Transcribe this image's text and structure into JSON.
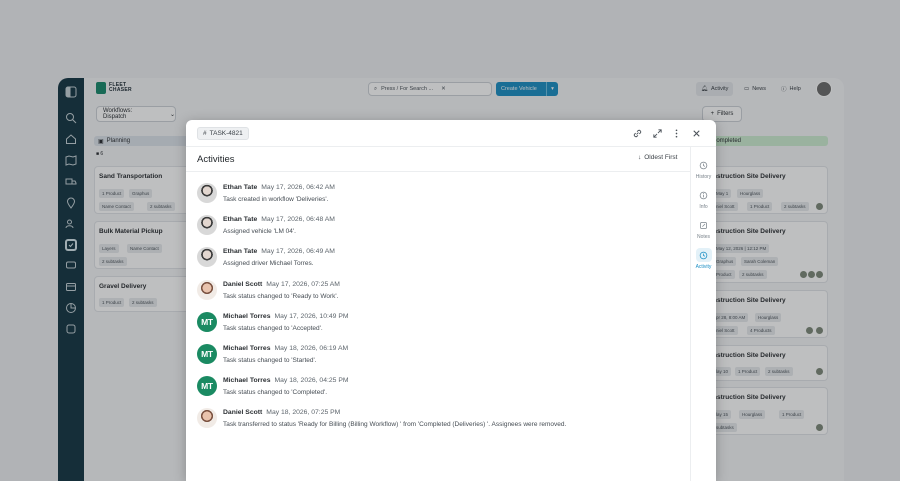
{
  "app": {
    "logo_text_1": "FLEET",
    "logo_text_2": "CHASER",
    "search_placeholder": "Press / For Search ...",
    "create_button": "Create Vehicle",
    "activity_label": "Activity",
    "news_label": "News",
    "help_label": "Help",
    "workflow_select": "Workflows: Dispatch",
    "filters_label": "Filters"
  },
  "board": {
    "planning_label": "Planning",
    "planning_count": "6",
    "completed_label": "Completed",
    "left_cards": [
      {
        "title": "Sand Transportation",
        "chips": [
          "1 Product",
          "Graphus",
          "Name Contact",
          "2 subtasks"
        ]
      },
      {
        "title": "Bulk Material Pickup",
        "chips": [
          "Layers",
          "Name Contact",
          "2 subtasks"
        ]
      },
      {
        "title": "Gravel Delivery",
        "chips": [
          "1 Product",
          "2 subtasks"
        ]
      }
    ],
    "right_cards": [
      {
        "title": "nstruction Site Delivery",
        "chips": [
          "May 1",
          "Hourglass",
          "niel Scott",
          "1 Product",
          "2 subtasks"
        ]
      },
      {
        "title": "nstruction Site Delivery",
        "chips": [
          "May 12, 2026 | 12:12 PM",
          "Graphus",
          "Sarah Coleman",
          "Product",
          "2 subtasks"
        ]
      },
      {
        "title": "nstruction Site Delivery",
        "chips": [
          "pr 28, 8:00 AM",
          "Hourglass",
          "niel Scott",
          "4 Products"
        ]
      },
      {
        "title": "nstruction Site Delivery",
        "chips": [
          "lay 10",
          "1 Product",
          "2 subtasks"
        ]
      },
      {
        "title": "nstruction Site Delivery",
        "chips": [
          "lay 15",
          "Hourglass",
          "1 Product",
          "subtasks"
        ]
      }
    ]
  },
  "modal": {
    "task_id": "TASK-4821",
    "title": "Activities",
    "sort_label": "Oldest First",
    "rail": [
      {
        "label": "History",
        "icon": "history-icon"
      },
      {
        "label": "Info",
        "icon": "info-icon"
      },
      {
        "label": "Notes",
        "icon": "notes-icon"
      },
      {
        "label": "Activity",
        "icon": "clock-icon"
      }
    ],
    "activities": [
      {
        "name": "Ethan Tate",
        "time": "May 17, 2026, 06:42 AM",
        "text": "Task created in workflow 'Deliveries'.",
        "avatar": "photo1",
        "initials": ""
      },
      {
        "name": "Ethan Tate",
        "time": "May 17, 2026, 06:48 AM",
        "text": "Assigned vehicle 'LM 04'.",
        "avatar": "photo1",
        "initials": ""
      },
      {
        "name": "Ethan Tate",
        "time": "May 17, 2026, 06:49 AM",
        "text": "Assigned driver Michael Torres.",
        "avatar": "photo1",
        "initials": ""
      },
      {
        "name": "Daniel Scott",
        "time": "May 17, 2026, 07:25 AM",
        "text": "Task status changed to 'Ready to Work'.",
        "avatar": "photo2",
        "initials": ""
      },
      {
        "name": "Michael Torres",
        "time": "May 17, 2026, 10:49 PM",
        "text": "Task status changed to 'Accepted'.",
        "avatar": "mt",
        "initials": "MT"
      },
      {
        "name": "Michael Torres",
        "time": "May 18, 2026, 06:19 AM",
        "text": "Task status changed to 'Started'.",
        "avatar": "mt",
        "initials": "MT"
      },
      {
        "name": "Michael Torres",
        "time": "May 18, 2026, 04:25 PM",
        "text": "Task status changed to 'Completed'.",
        "avatar": "mt",
        "initials": "MT"
      },
      {
        "name": "Daniel Scott",
        "time": "May 18, 2026, 07:25 PM",
        "text": "Task transferred to status 'Ready for Billing (Billing Workflow) ' from 'Completed (Deliveries) '. Assignees were removed.",
        "avatar": "photo2",
        "initials": ""
      }
    ]
  }
}
